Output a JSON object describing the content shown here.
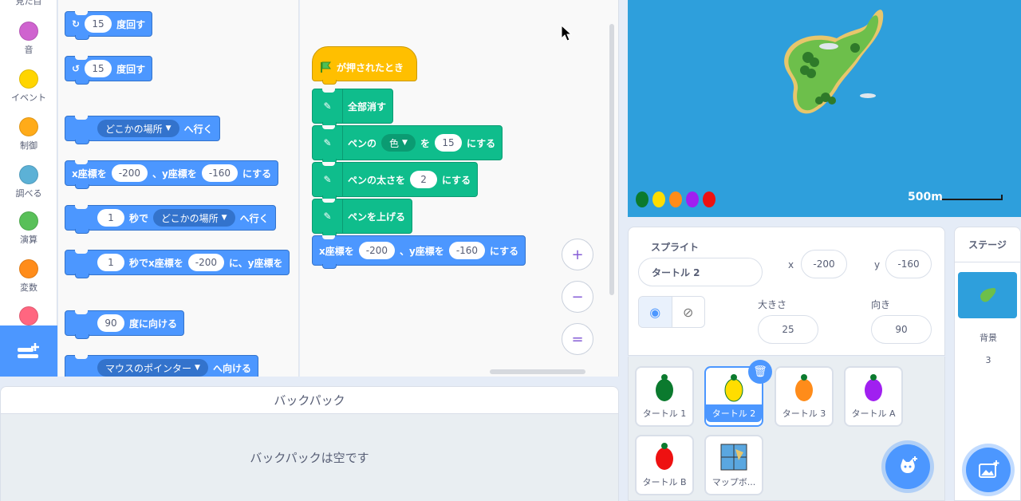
{
  "categories": [
    {
      "label": "見た目",
      "color": "#9966ff"
    },
    {
      "label": "音",
      "color": "#cf63cf"
    },
    {
      "label": "イベント",
      "color": "#ffd500"
    },
    {
      "label": "制御",
      "color": "#ffab19"
    },
    {
      "label": "調べる",
      "color": "#5cb1d6"
    },
    {
      "label": "演算",
      "color": "#59c059"
    },
    {
      "label": "変数",
      "color": "#ff8c1a"
    },
    {
      "label": "",
      "color": "#ff6680"
    }
  ],
  "palette": {
    "turn_right": {
      "value": "15",
      "label": "度回す"
    },
    "turn_left": {
      "value": "15",
      "label": "度回す"
    },
    "goto": {
      "dropdown": "どこかの場所",
      "label": "へ行く"
    },
    "setxy": {
      "x_label": "x座標を",
      "x": "-200",
      "y_label": "、y座標を",
      "y": "-160",
      "end": "にする"
    },
    "glide": {
      "secs": "1",
      "secs_label": "秒で",
      "dropdown": "どこかの場所",
      "label": "へ行く"
    },
    "glidexy": {
      "secs": "1",
      "label": "秒でx座標を",
      "x": "-200",
      "mid": "に、y座標を"
    },
    "point": {
      "value": "90",
      "label": "度に向ける"
    },
    "pointto": {
      "dropdown": "マウスのポインター",
      "label": "へ向ける"
    }
  },
  "script": {
    "hat": "が押されたとき",
    "clear": "全部消す",
    "pen_set": {
      "label": "ペンの",
      "dropdown": "色",
      "mid": "を",
      "value": "15",
      "end": "にする"
    },
    "pen_size": {
      "label": "ペンの太さを",
      "value": "2",
      "end": "にする"
    },
    "pen_down": "ペンを上げる",
    "setxy": {
      "x_label": "x座標を",
      "x": "-200",
      "y_label": "、y座標を",
      "y": "-160",
      "end": "にする"
    }
  },
  "zoom": {
    "in": "+",
    "out": "−",
    "reset": "="
  },
  "backpack": {
    "title": "バックパック",
    "empty": "バックパックは空です"
  },
  "stage": {
    "scale": "500m"
  },
  "sprite_info": {
    "sprite_label": "スプライト",
    "name": "タートル 2",
    "x_label": "x",
    "x": "-200",
    "y_label": "y",
    "y": "-160",
    "size_label": "大きさ",
    "size": "25",
    "direction_label": "向き",
    "direction": "90"
  },
  "sprites": [
    {
      "name": "タートル 1",
      "color": "#0b7a2e"
    },
    {
      "name": "タートル 2",
      "color": "#ffdd00"
    },
    {
      "name": "タートル 3",
      "color": "#ff8c1a"
    },
    {
      "name": "タートル A",
      "color": "#a020f0"
    },
    {
      "name": "タートル B",
      "color": "#ee1111"
    },
    {
      "name": "マップボ...",
      "color": "#4c97ff"
    }
  ],
  "stage_panel": {
    "title": "ステージ",
    "backdrop_label": "背景",
    "backdrop_count": "3"
  }
}
